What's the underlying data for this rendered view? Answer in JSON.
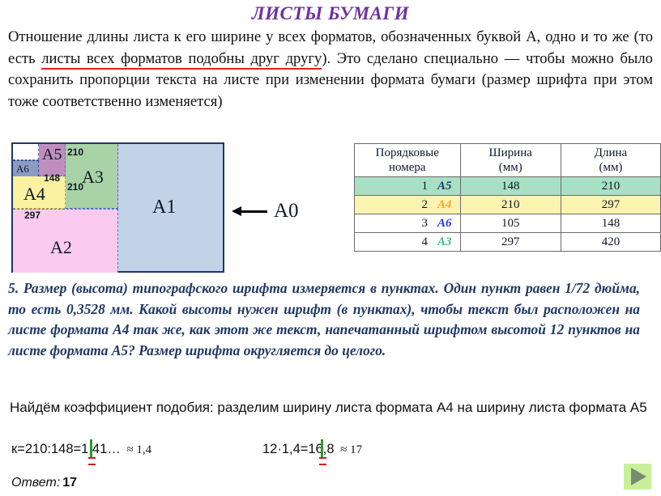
{
  "title": "ЛИСТЫ БУМАГИ",
  "intro": {
    "part1": "Отношение длины листа к его ширине у всех форматов, обозначенных буквой А, одно и то же (то есть ",
    "underlined": "листы всех форматов подобны друг другу",
    "part2": "). Это сделано специально — чтобы можно было сохранить пропорции текста на листе при изменении формата бумаги (размер шрифта при этом тоже соответственно изменяется)"
  },
  "diagram": {
    "zones": [
      {
        "name": "A1",
        "label": "А1"
      },
      {
        "name": "A2",
        "label": "А2"
      },
      {
        "name": "A3",
        "label": "А3"
      },
      {
        "name": "A4",
        "label": "А4"
      },
      {
        "name": "A5",
        "label": "А5"
      },
      {
        "name": "A6",
        "label": "А6"
      }
    ],
    "dimensions": {
      "a3_width": "210",
      "a5_width": "148",
      "a4_width": "210",
      "a4_height": "297"
    },
    "outer_label": "А0"
  },
  "table": {
    "headers": {
      "order_line1": "Порядковые",
      "order_line2": "номера",
      "width_line1": "Ширина",
      "width_line2": "(мм)",
      "length_line1": "Длина",
      "length_line2": "(мм)"
    },
    "rows": [
      {
        "num": "1",
        "format": "А5",
        "width": "148",
        "length": "210"
      },
      {
        "num": "2",
        "format": "А4",
        "width": "210",
        "length": "297"
      },
      {
        "num": "3",
        "format": "А6",
        "width": "105",
        "length": "148"
      },
      {
        "num": "4",
        "format": "А3",
        "width": "297",
        "length": "420"
      }
    ]
  },
  "problem": {
    "number": "5.",
    "text": " Размер (высота) типографского шрифта измеряется в пунктах. Один пункт равен 1/72 дюйма, то есть 0,3528 мм. Какой высоты нужен шрифт (в пунктах), чтобы текст был расположен на листе формата А4 так же, как этот же текст, напечатанный шрифтом высотой 12 пунктов на листе формата А5? Размер шрифта округляется до целого."
  },
  "solution": {
    "step_text": "Найдём коэффициент подобия: разделим ширину листа формата А4 на ширину листа  формата А5",
    "calc1_main": "к=210:148=1,41…",
    "calc1_approx": "≈ 1,4",
    "calc2_main": "12·1,4=16,8",
    "calc2_approx": "≈ 17",
    "answer_label": "Ответ:",
    "answer_value": "17"
  },
  "controls": {
    "next_label": "next-slide"
  },
  "colors": {
    "title": "#7030A0",
    "problem_text": "#1F3864",
    "underline": "#E8201A",
    "caret": "#2E9B2E",
    "next_button_bg": "#C8F09A"
  }
}
